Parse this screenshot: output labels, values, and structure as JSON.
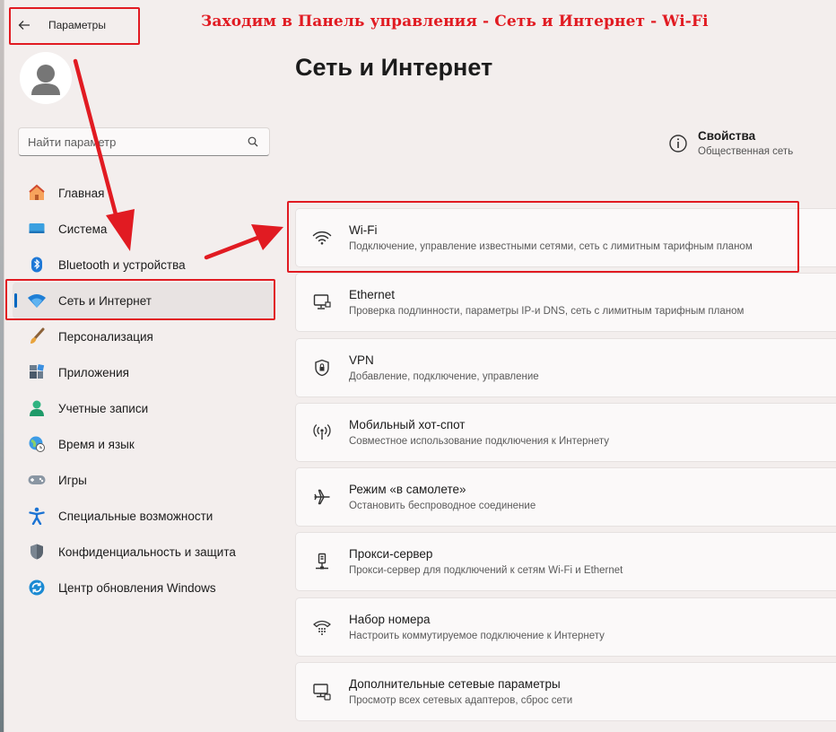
{
  "app": {
    "title": "Параметры"
  },
  "annotation": {
    "heading": "Заходим в Панель управления - Сеть и Интернет - Wi-Fi"
  },
  "search": {
    "placeholder": "Найти параметр"
  },
  "sidebar": {
    "items": [
      {
        "label": "Главная",
        "icon": "home-icon"
      },
      {
        "label": "Система",
        "icon": "display-icon"
      },
      {
        "label": "Bluetooth и устройства",
        "icon": "bluetooth-icon"
      },
      {
        "label": "Сеть и Интернет",
        "icon": "wifi-icon",
        "active": true
      },
      {
        "label": "Персонализация",
        "icon": "brush-icon"
      },
      {
        "label": "Приложения",
        "icon": "apps-icon"
      },
      {
        "label": "Учетные записи",
        "icon": "person-icon"
      },
      {
        "label": "Время и язык",
        "icon": "globe-clock-icon"
      },
      {
        "label": "Игры",
        "icon": "gamepad-icon"
      },
      {
        "label": "Специальные возможности",
        "icon": "accessibility-icon"
      },
      {
        "label": "Конфиденциальность и защита",
        "icon": "shield-icon"
      },
      {
        "label": "Центр обновления Windows",
        "icon": "update-icon"
      }
    ]
  },
  "main": {
    "title": "Сеть и Интернет",
    "properties": {
      "title": "Свойства",
      "subtitle": "Общественная сеть"
    },
    "cards": [
      {
        "title": "Wi-Fi",
        "subtitle": "Подключение, управление известными сетями, сеть с лимитным тарифным планом",
        "icon": "wifi-icon"
      },
      {
        "title": "Ethernet",
        "subtitle": "Проверка подлинности, параметры IP-и DNS, сеть с лимитным тарифным планом",
        "icon": "ethernet-icon"
      },
      {
        "title": "VPN",
        "subtitle": "Добавление, подключение, управление",
        "icon": "vpn-shield-icon"
      },
      {
        "title": "Мобильный хот-спот",
        "subtitle": "Совместное использование подключения к Интернету",
        "icon": "hotspot-icon"
      },
      {
        "title": "Режим «в самолете»",
        "subtitle": "Остановить беспроводное соединение",
        "icon": "airplane-icon"
      },
      {
        "title": "Прокси-сервер",
        "subtitle": "Прокси-сервер для подключений к сетям Wi-Fi и Ethernet",
        "icon": "proxy-icon"
      },
      {
        "title": "Набор номера",
        "subtitle": "Настроить коммутируемое подключение к Интернету",
        "icon": "dialup-icon"
      },
      {
        "title": "Дополнительные сетевые параметры",
        "subtitle": "Просмотр всех сетевых адаптеров, сброс сети",
        "icon": "network-adapter-icon"
      }
    ]
  },
  "colors": {
    "accent": "#0067c0",
    "annotation_red": "#e11b22",
    "background": "#f3eeed"
  }
}
